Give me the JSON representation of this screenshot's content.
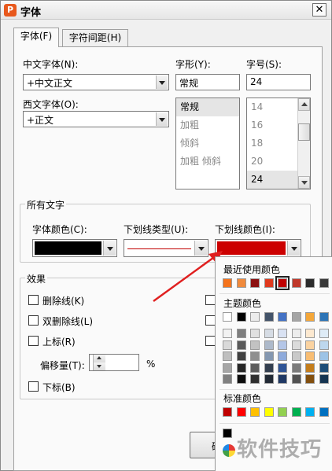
{
  "window": {
    "app_icon": "P",
    "title": "字体",
    "close": "✕"
  },
  "tabs": [
    {
      "label": "字体(F)"
    },
    {
      "label": "字符间距(H)"
    }
  ],
  "font": {
    "chinese_label": "中文字体(N):",
    "chinese_value": "+中文正文",
    "western_label": "西文字体(O):",
    "western_value": "+正文",
    "style_label": "字形(Y):",
    "style_value": "常规",
    "style_options": [
      "常规",
      "加粗",
      "倾斜",
      "加粗 倾斜"
    ],
    "size_label": "字号(S):",
    "size_value": "24",
    "size_options": [
      "14",
      "16",
      "18",
      "20",
      "24"
    ]
  },
  "all_text": {
    "group_label": "所有文字",
    "font_color_label": "字体颜色(C):",
    "underline_type_label": "下划线类型(U):",
    "underline_color_label": "下划线颜色(I):",
    "font_color": "#000000",
    "underline_line_color": "#c00000",
    "underline_color": "#cc0000"
  },
  "effects": {
    "group_label": "效果",
    "strikethrough": "删除线(K)",
    "double_strikethrough": "双删除线(L)",
    "superscript": "上标(R)",
    "offset_label": "偏移量(T):",
    "offset_value": "0",
    "offset_unit": "%",
    "subscript": "下标(B)"
  },
  "buttons": {
    "ok": "确"
  },
  "color_popup": {
    "recent_label": "最近使用颜色",
    "recent_colors": [
      "#f4731c",
      "#f08a3c",
      "#8b1010",
      "#e03a1e",
      "#c00000",
      "#c0392b",
      "#2b2b2b",
      "#3a3a3a"
    ],
    "theme_label": "主题颜色",
    "theme_top": [
      "#ffffff",
      "#000000",
      "#ececec",
      "#44546a",
      "#4472c4",
      "#a5a5a5",
      "#f4a73a",
      "#2e75b6"
    ],
    "theme_shades": [
      [
        "#f2f2f2",
        "#d9d9d9",
        "#bfbfbf",
        "#a6a6a6",
        "#808080"
      ],
      [
        "#7f7f7f",
        "#595959",
        "#404040",
        "#262626",
        "#0d0d0d"
      ],
      [
        "#e0e0e0",
        "#c2c2c2",
        "#8f8f8f",
        "#5c5c5c",
        "#2e2e2e"
      ],
      [
        "#d6dce4",
        "#adb9ca",
        "#8497b0",
        "#333f4f",
        "#222a35"
      ],
      [
        "#d9e2f3",
        "#b4c6e7",
        "#8eaadb",
        "#2f5496",
        "#1f3864"
      ],
      [
        "#ededed",
        "#dbdbdb",
        "#c9c9c9",
        "#7b7b7b",
        "#525252"
      ],
      [
        "#fde9d0",
        "#fbd3a1",
        "#f8bd73",
        "#c47d1c",
        "#834f0e"
      ],
      [
        "#deebf6",
        "#bdd7ee",
        "#9dc3e6",
        "#1f4e79",
        "#153451"
      ]
    ],
    "standard_label": "标准颜色",
    "standard_colors": [
      "#c00000",
      "#ff0000",
      "#ffc000",
      "#ffff00",
      "#92d050",
      "#00b050",
      "#00b0f0",
      "#0070c0"
    ],
    "extra_color": "#000000"
  },
  "watermark": "软件技巧"
}
